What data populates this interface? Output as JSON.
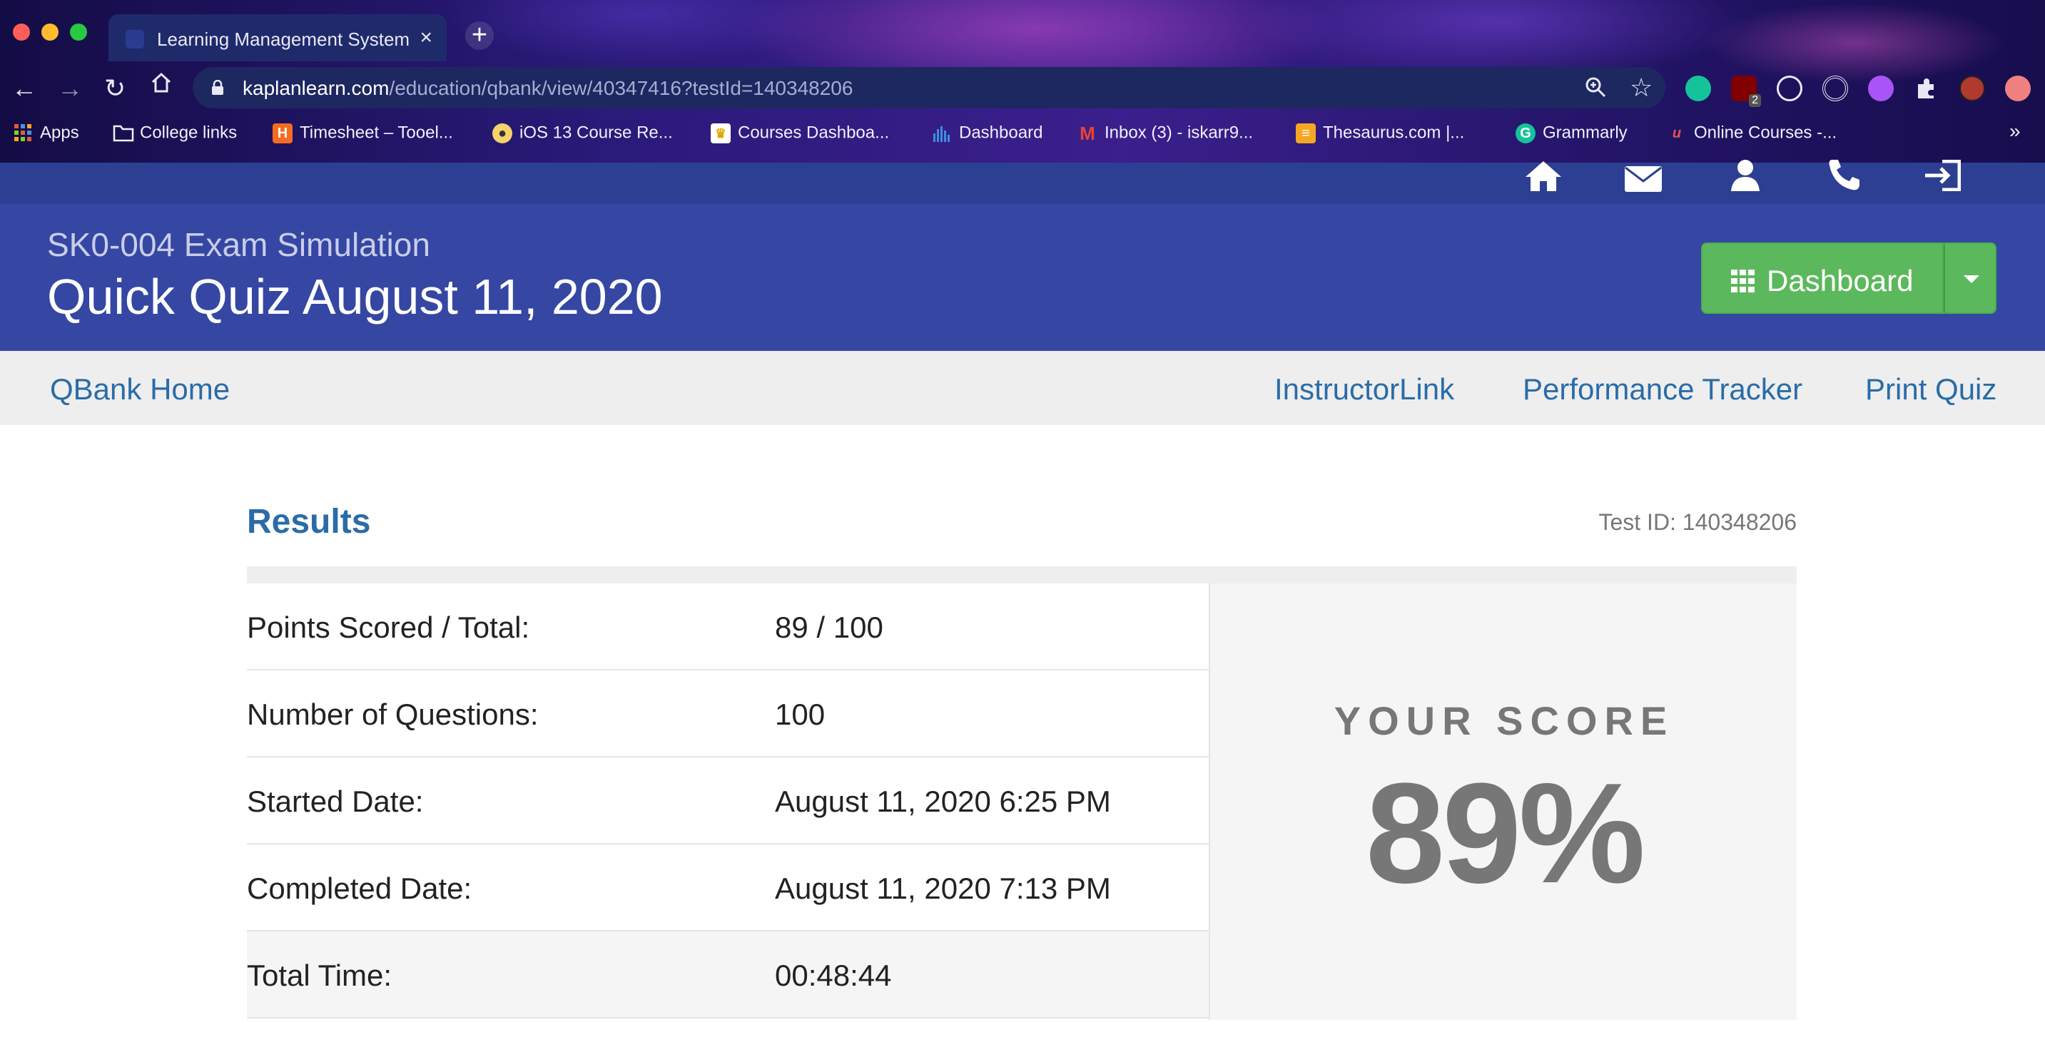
{
  "browser": {
    "tab_title": "Learning Management System",
    "tab_close": "×",
    "new_tab": "+",
    "url_host": "kaplanlearn.com",
    "url_path": "/education/qbank/view/40347416?testId=140348206",
    "extension_badge": "2",
    "bookmarks": [
      "Apps",
      "College links",
      "Timesheet – Tooel...",
      "iOS 13 Course Re...",
      "Courses Dashboa...",
      "Dashboard",
      "Inbox (3) - iskarr9...",
      "Thesaurus.com |...",
      "Grammarly",
      "Online Courses -..."
    ],
    "bookmarks_more": "»"
  },
  "header": {
    "subtitle": "SK0-004 Exam Simulation",
    "title": "Quick Quiz August 11, 2020",
    "dashboard_label": "Dashboard"
  },
  "subnav": {
    "qbank_home": "QBank Home",
    "instructor_link": "InstructorLink",
    "performance_tracker": "Performance Tracker",
    "print_quiz": "Print Quiz"
  },
  "results": {
    "heading": "Results",
    "test_id": "Test ID: 140348206",
    "rows": [
      {
        "label": "Points Scored / Total:",
        "value": "89 / 100"
      },
      {
        "label": "Number of Questions:",
        "value": "100"
      },
      {
        "label": "Started Date:",
        "value": "August 11, 2020 6:25 PM"
      },
      {
        "label": "Completed Date:",
        "value": "August 11, 2020 7:13 PM"
      },
      {
        "label": "Total Time:",
        "value": "00:48:44"
      }
    ],
    "score_caption": "YOUR SCORE",
    "score_value": "89%"
  },
  "colors": {
    "header_bg": "#3547a3",
    "link": "#2a6ca8",
    "dashboard_green": "#5cb85c",
    "score_gray": "#777777"
  }
}
